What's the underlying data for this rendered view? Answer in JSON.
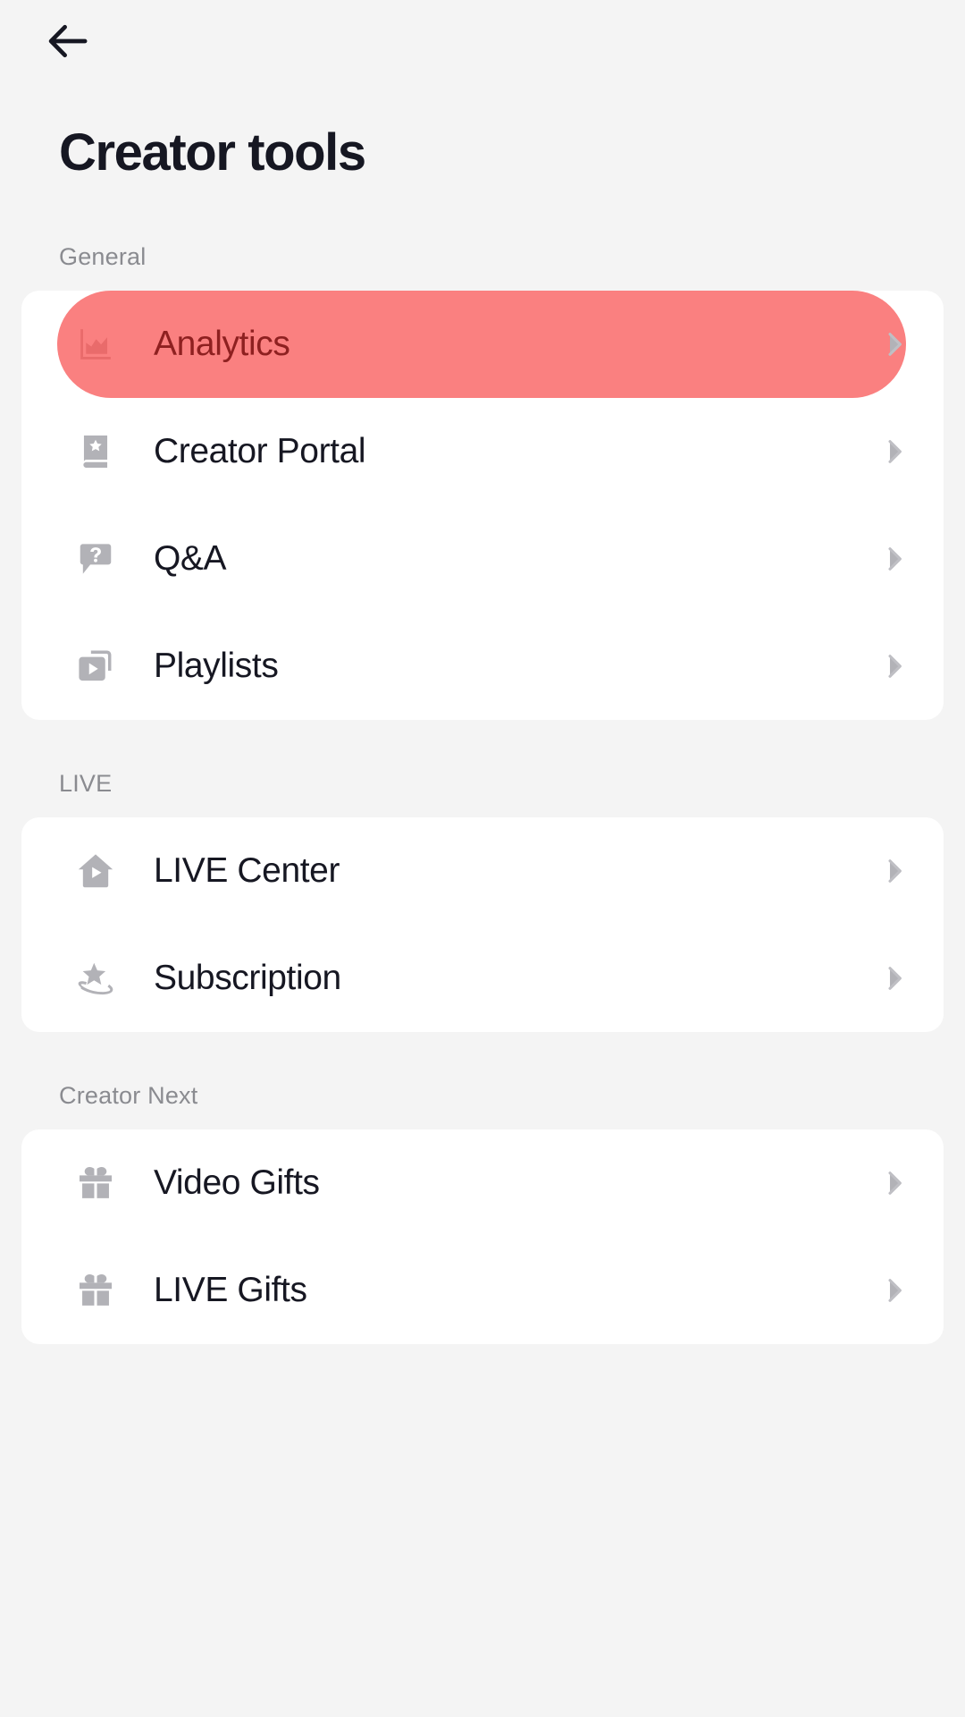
{
  "header": {
    "back_icon": "arrow-left-icon",
    "title": "Creator tools"
  },
  "colors": {
    "page_background": "#F4F4F4",
    "card_background": "#FFFFFF",
    "text_primary": "#161722",
    "text_secondary": "#8A8B90",
    "icon_gray": "#B2B2B7",
    "highlight_pill": "#FA8080",
    "highlight_text": "#8E2020"
  },
  "sections": [
    {
      "label": "General",
      "items": [
        {
          "label": "Analytics",
          "icon": "chart-analytics-icon",
          "chevron": "chevron-right-icon",
          "highlighted": true
        },
        {
          "label": "Creator Portal",
          "icon": "book-star-icon",
          "chevron": "chevron-right-icon",
          "highlighted": false
        },
        {
          "label": "Q&A",
          "icon": "question-bubble-icon",
          "chevron": "chevron-right-icon",
          "highlighted": false
        },
        {
          "label": "Playlists",
          "icon": "playlist-play-icon",
          "chevron": "chevron-right-icon",
          "highlighted": false
        }
      ]
    },
    {
      "label": "LIVE",
      "items": [
        {
          "label": "LIVE Center",
          "icon": "house-play-icon",
          "chevron": "chevron-right-icon",
          "highlighted": false
        },
        {
          "label": "Subscription",
          "icon": "planet-star-icon",
          "chevron": "chevron-right-icon",
          "highlighted": false
        }
      ]
    },
    {
      "label": "Creator Next",
      "items": [
        {
          "label": "Video Gifts",
          "icon": "gift-box-icon",
          "chevron": "chevron-right-icon",
          "highlighted": false
        },
        {
          "label": "LIVE Gifts",
          "icon": "gift-box-icon",
          "chevron": "chevron-right-icon",
          "highlighted": false
        }
      ]
    }
  ]
}
